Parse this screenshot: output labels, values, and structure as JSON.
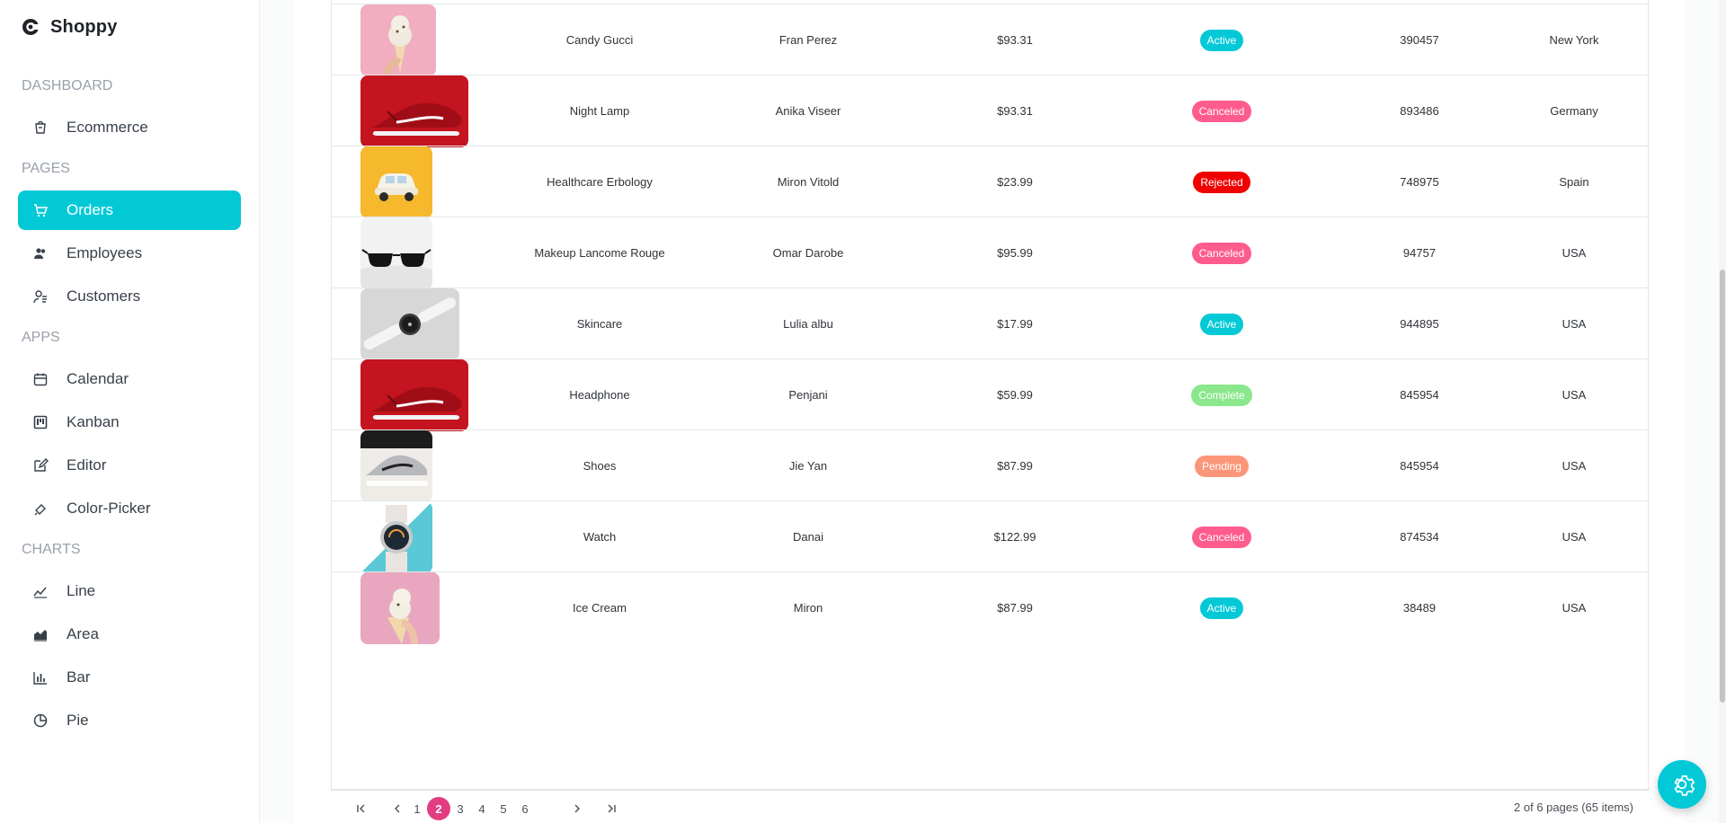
{
  "app": {
    "name": "Shoppy"
  },
  "colors": {
    "accent": "#03c9d7",
    "active_badge": "#03c9d7",
    "canceled": "#ff5c8e",
    "rejected": "#f00000",
    "complete": "#8be78b",
    "pending": "#fb9678",
    "pager_current": "#e23d82"
  },
  "sidebar": {
    "sections": [
      {
        "title": "DASHBOARD",
        "items": [
          {
            "label": "Ecommerce",
            "icon": "shopping-bag-icon"
          }
        ]
      },
      {
        "title": "PAGES",
        "items": [
          {
            "label": "Orders",
            "icon": "cart-icon",
            "active": true
          },
          {
            "label": "Employees",
            "icon": "employees-icon"
          },
          {
            "label": "Customers",
            "icon": "customers-icon"
          }
        ]
      },
      {
        "title": "APPS",
        "items": [
          {
            "label": "Calendar",
            "icon": "calendar-icon"
          },
          {
            "label": "Kanban",
            "icon": "kanban-icon"
          },
          {
            "label": "Editor",
            "icon": "editor-icon"
          },
          {
            "label": "Color-Picker",
            "icon": "color-picker-icon"
          }
        ]
      },
      {
        "title": "CHARTS",
        "items": [
          {
            "label": "Line",
            "icon": "line-chart-icon"
          },
          {
            "label": "Area",
            "icon": "area-chart-icon"
          },
          {
            "label": "Bar",
            "icon": "bar-chart-icon"
          },
          {
            "label": "Pie",
            "icon": "pie-chart-icon"
          }
        ]
      }
    ]
  },
  "orders": [
    {
      "image": "ice-cream-cone",
      "item": "Candy Gucci",
      "customer": "Fran Perez",
      "amount": "$93.31",
      "status": "Active",
      "order_id": "390457",
      "location": "New York"
    },
    {
      "image": "red-sneaker",
      "item": "Night Lamp",
      "customer": "Anika Viseer",
      "amount": "$93.31",
      "status": "Canceled",
      "order_id": "893486",
      "location": "Germany"
    },
    {
      "image": "toy-car-yellow",
      "item": "Healthcare Erbology",
      "customer": "Miron Vitold",
      "amount": "$23.99",
      "status": "Rejected",
      "order_id": "748975",
      "location": "Spain"
    },
    {
      "image": "sunglasses",
      "item": "Makeup Lancome Rouge",
      "customer": "Omar Darobe",
      "amount": "$95.99",
      "status": "Canceled",
      "order_id": "94757",
      "location": "USA"
    },
    {
      "image": "smartwatch-white",
      "item": "Skincare",
      "customer": "Lulia albu",
      "amount": "$17.99",
      "status": "Active",
      "order_id": "944895",
      "location": "USA"
    },
    {
      "image": "red-sneaker",
      "item": "Headphone",
      "customer": "Penjani",
      "amount": "$59.99",
      "status": "Complete",
      "order_id": "845954",
      "location": "USA"
    },
    {
      "image": "grey-sneaker",
      "item": "Shoes",
      "customer": "Jie Yan",
      "amount": "$87.99",
      "status": "Pending",
      "order_id": "845954",
      "location": "USA"
    },
    {
      "image": "smartwatch-teal",
      "item": "Watch",
      "customer": "Danai",
      "amount": "$122.99",
      "status": "Canceled",
      "order_id": "874534",
      "location": "USA"
    },
    {
      "image": "ice-cream-pink",
      "item": "Ice Cream",
      "customer": "Miron",
      "amount": "$87.99",
      "status": "Active",
      "order_id": "38489",
      "location": "USA"
    }
  ],
  "pager": {
    "pages": [
      "1",
      "2",
      "3",
      "4",
      "5",
      "6"
    ],
    "current": "2",
    "info": "2 of 6 pages (65 items)",
    "first_icon": "first-page-icon",
    "prev_icon": "prev-page-icon",
    "next_icon": "next-page-icon",
    "last_icon": "last-page-icon"
  },
  "fab": {
    "icon": "settings-gear-icon"
  }
}
